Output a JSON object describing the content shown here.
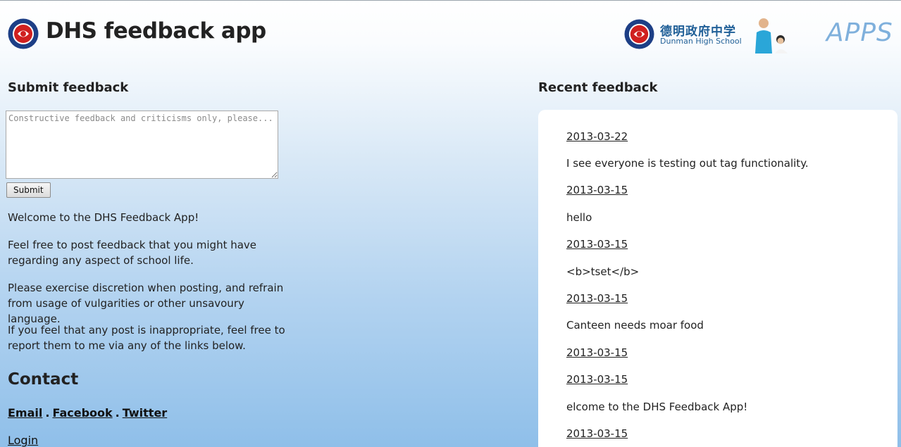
{
  "header": {
    "title": "DHS feedback app",
    "school_chinese": "德明政府中学",
    "school_english": "Dunman High School",
    "apps_label": "APPS"
  },
  "submit": {
    "heading": "Submit feedback",
    "placeholder": "Constructive feedback and criticisms only, please...",
    "button_label": "Submit"
  },
  "intro": {
    "p1": "Welcome to the DHS Feedback App!",
    "p2": "Feel free to post feedback that you might have regarding any aspect of school life.",
    "p3": "Please exercise discretion when posting, and refrain from usage of vulgarities or other unsavoury language.",
    "p4": "If you feel that any post is inappropriate, feel free to report them to me via any of the links below."
  },
  "contact": {
    "heading": "Contact",
    "links": [
      "Email",
      "Facebook",
      "Twitter"
    ],
    "separator": ".",
    "login": "Login"
  },
  "recent": {
    "heading": "Recent feedback",
    "entries": [
      {
        "kind": "date",
        "text": "2013-03-22"
      },
      {
        "kind": "text",
        "text": "I see everyone is testing out tag functionality."
      },
      {
        "kind": "date",
        "text": "2013-03-15"
      },
      {
        "kind": "text",
        "text": "hello"
      },
      {
        "kind": "date",
        "text": "2013-03-15"
      },
      {
        "kind": "text",
        "text": "<b>tset</b>"
      },
      {
        "kind": "date",
        "text": "2013-03-15"
      },
      {
        "kind": "text",
        "text": "Canteen needs moar food"
      },
      {
        "kind": "date",
        "text": "2013-03-15"
      },
      {
        "kind": "date",
        "text": "2013-03-15"
      },
      {
        "kind": "text",
        "text": "elcome to the DHS Feedback App!"
      },
      {
        "kind": "date",
        "text": "2013-03-15"
      }
    ]
  },
  "colors": {
    "accent_blue": "#1f5f97",
    "apps_blue": "#7fb0dc",
    "crest_red": "#d0201f"
  }
}
